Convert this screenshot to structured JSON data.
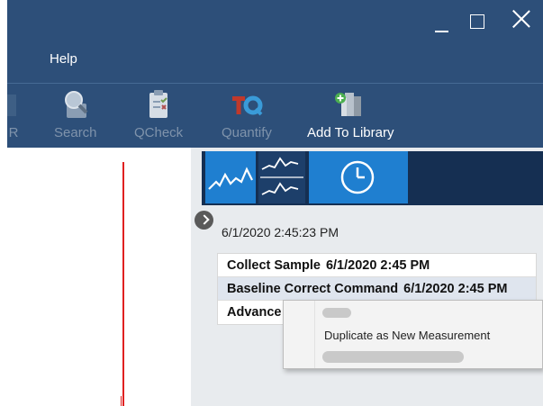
{
  "window": {
    "menu": {
      "help": "Help"
    },
    "controls": {
      "minimize": "minimize-icon",
      "maximize": "maximize-icon",
      "close": "close-icon"
    }
  },
  "toolbar": {
    "items": [
      {
        "label": "R",
        "icon": "partial-icon",
        "enabled": false
      },
      {
        "label": "Search",
        "icon": "search-icon",
        "enabled": false
      },
      {
        "label": "QCheck",
        "icon": "clipboard-check-icon",
        "enabled": false
      },
      {
        "label": "Quantify",
        "icon": "tq-logo-icon",
        "enabled": false
      },
      {
        "label": "Add To Library",
        "icon": "add-to-library-icon",
        "enabled": true
      }
    ]
  },
  "view_buttons": [
    "spectrum-view-icon",
    "stacked-view-icon",
    "history-clock-icon"
  ],
  "history": {
    "timestamp": "6/1/2020 2:45:23 PM",
    "rows": [
      {
        "command": "Collect Sample",
        "time": "6/1/2020 2:45 PM",
        "selected": false
      },
      {
        "command": "Baseline Correct Command",
        "time": "6/1/2020 2:45 PM",
        "selected": true
      },
      {
        "command": "Advance",
        "time": "",
        "selected": false
      }
    ]
  },
  "context_menu": {
    "items": [
      "Duplicate as New Measurement"
    ]
  },
  "colors": {
    "titlebar": "#2d4f79",
    "view_bar": "#152f52",
    "view_button": "#1f7fd0",
    "spectrum_line": "#e02020"
  }
}
